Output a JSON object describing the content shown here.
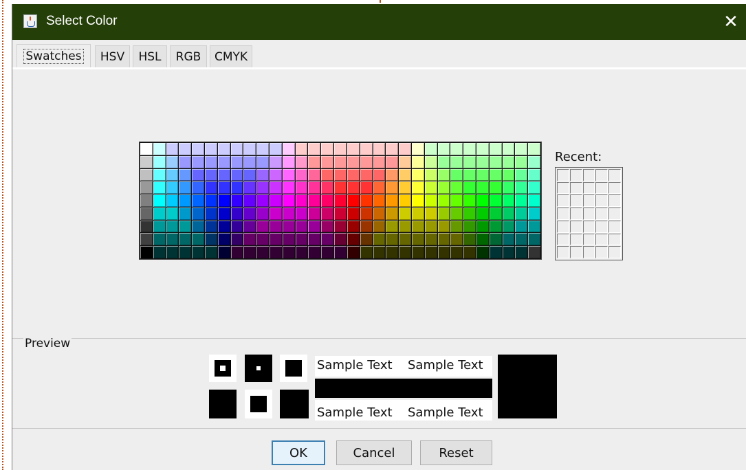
{
  "window": {
    "title": "Select Color",
    "close_icon": "close-icon",
    "app_icon": "java-icon"
  },
  "tabs": [
    {
      "label": "Swatches",
      "selected": true
    },
    {
      "label": "HSV",
      "selected": false
    },
    {
      "label": "HSL",
      "selected": false
    },
    {
      "label": "RGB",
      "selected": false
    },
    {
      "label": "CMYK",
      "selected": false
    }
  ],
  "swatches": {
    "columns": 31,
    "rows": 9,
    "colors": [
      [
        "#ffffff",
        "#ccffff",
        "#ccccff",
        "#ccccff",
        "#ccccff",
        "#ccccff",
        "#ccccff",
        "#ccccff",
        "#ccccff",
        "#ccccff",
        "#ccccff",
        "#ffccff",
        "#ffcccc",
        "#ffcccc",
        "#ffcccc",
        "#ffcccc",
        "#ffcccc",
        "#ffcccc",
        "#ffcccc",
        "#ffcccc",
        "#ffcccc",
        "#ffffcc",
        "#ccffcc",
        "#ccffcc",
        "#ccffcc",
        "#ccffcc",
        "#ccffcc",
        "#ccffcc",
        "#ccffcc",
        "#ccffcc",
        "#ccffcc"
      ],
      [
        "#cccccc",
        "#99ffff",
        "#99ccff",
        "#9999ff",
        "#9999ff",
        "#9999ff",
        "#9999ff",
        "#9999ff",
        "#9999ff",
        "#9999ff",
        "#cc99ff",
        "#ff99ff",
        "#ff99cc",
        "#ff9999",
        "#ff9999",
        "#ff9999",
        "#ff9999",
        "#ff9999",
        "#ff9999",
        "#ff9999",
        "#ffcc99",
        "#ffff99",
        "#ccff99",
        "#99ff99",
        "#99ff99",
        "#99ff99",
        "#99ff99",
        "#99ff99",
        "#99ff99",
        "#99ff99",
        "#99ffcc"
      ],
      [
        "#c0c0c0",
        "#66ffff",
        "#66ccff",
        "#6699ff",
        "#6666ff",
        "#6666ff",
        "#6666ff",
        "#6666ff",
        "#6666ff",
        "#9966ff",
        "#cc66ff",
        "#ff66ff",
        "#ff66cc",
        "#ff6699",
        "#ff6666",
        "#ff6666",
        "#ff6666",
        "#ff6666",
        "#ff6666",
        "#ff9966",
        "#ffcc66",
        "#ffff66",
        "#ccff66",
        "#99ff66",
        "#66ff66",
        "#66ff66",
        "#66ff66",
        "#66ff66",
        "#66ff66",
        "#66ff99",
        "#66ffcc"
      ],
      [
        "#999999",
        "#33ffff",
        "#33ccff",
        "#3399ff",
        "#3366ff",
        "#3333ff",
        "#3333ff",
        "#3333ff",
        "#6633ff",
        "#9933ff",
        "#cc33ff",
        "#ff33ff",
        "#ff33cc",
        "#ff3399",
        "#ff3366",
        "#ff3333",
        "#ff3333",
        "#ff3333",
        "#ff6633",
        "#ff9933",
        "#ffcc33",
        "#ffff33",
        "#ccff33",
        "#99ff33",
        "#66ff33",
        "#33ff33",
        "#33ff33",
        "#33ff33",
        "#33ff66",
        "#33ff99",
        "#33ffcc"
      ],
      [
        "#808080",
        "#00ffff",
        "#00ccff",
        "#0099ff",
        "#0066ff",
        "#0033ff",
        "#0000ff",
        "#3300ff",
        "#6600ff",
        "#9900ff",
        "#cc00ff",
        "#ff00ff",
        "#ff00cc",
        "#ff0099",
        "#ff0066",
        "#ff0033",
        "#ff0000",
        "#ff3300",
        "#ff6600",
        "#ff9900",
        "#ffcc00",
        "#ffff00",
        "#ccff00",
        "#99ff00",
        "#66ff00",
        "#33ff00",
        "#00ff00",
        "#00ff33",
        "#00ff66",
        "#00ff99",
        "#00ffcc"
      ],
      [
        "#666666",
        "#00cccc",
        "#00cccc",
        "#0099cc",
        "#0066cc",
        "#0033cc",
        "#0000cc",
        "#3300cc",
        "#6600cc",
        "#9900cc",
        "#cc00cc",
        "#cc00cc",
        "#cc00cc",
        "#cc0099",
        "#cc0066",
        "#cc0033",
        "#cc0000",
        "#cc3300",
        "#cc6600",
        "#cc9900",
        "#cccc00",
        "#cccc00",
        "#cccc00",
        "#99cc00",
        "#66cc00",
        "#33cc00",
        "#00cc00",
        "#00cc33",
        "#00cc66",
        "#00cc99",
        "#00cccc"
      ],
      [
        "#333333",
        "#009999",
        "#009999",
        "#009999",
        "#006699",
        "#003399",
        "#000099",
        "#330099",
        "#660099",
        "#990099",
        "#990099",
        "#990099",
        "#990099",
        "#990099",
        "#990066",
        "#990033",
        "#990000",
        "#993300",
        "#996600",
        "#999900",
        "#999900",
        "#999900",
        "#999900",
        "#999900",
        "#669900",
        "#339900",
        "#009900",
        "#009933",
        "#009966",
        "#009999",
        "#009999"
      ],
      [
        "#404040",
        "#006666",
        "#006666",
        "#006666",
        "#006666",
        "#003366",
        "#000066",
        "#330066",
        "#660066",
        "#660066",
        "#660066",
        "#660066",
        "#660066",
        "#660066",
        "#660066",
        "#660033",
        "#660000",
        "#663300",
        "#666600",
        "#666600",
        "#666600",
        "#666600",
        "#666600",
        "#666600",
        "#666600",
        "#336600",
        "#006600",
        "#006633",
        "#006666",
        "#006666",
        "#006666"
      ],
      [
        "#000000",
        "#003333",
        "#003333",
        "#003333",
        "#003333",
        "#003333",
        "#000033",
        "#330033",
        "#330033",
        "#330033",
        "#330033",
        "#330033",
        "#330033",
        "#330033",
        "#330033",
        "#330033",
        "#330000",
        "#333300",
        "#333300",
        "#333300",
        "#333300",
        "#333300",
        "#333300",
        "#333300",
        "#333300",
        "#333300",
        "#003300",
        "#003333",
        "#003333",
        "#003333",
        "#333333"
      ]
    ]
  },
  "recent": {
    "label": "Recent:",
    "columns": 5,
    "rows": 7
  },
  "preview": {
    "label": "Preview",
    "sample_text": "Sample Text",
    "current_color": "#000000"
  },
  "buttons": {
    "ok": "OK",
    "cancel": "Cancel",
    "reset": "Reset"
  }
}
